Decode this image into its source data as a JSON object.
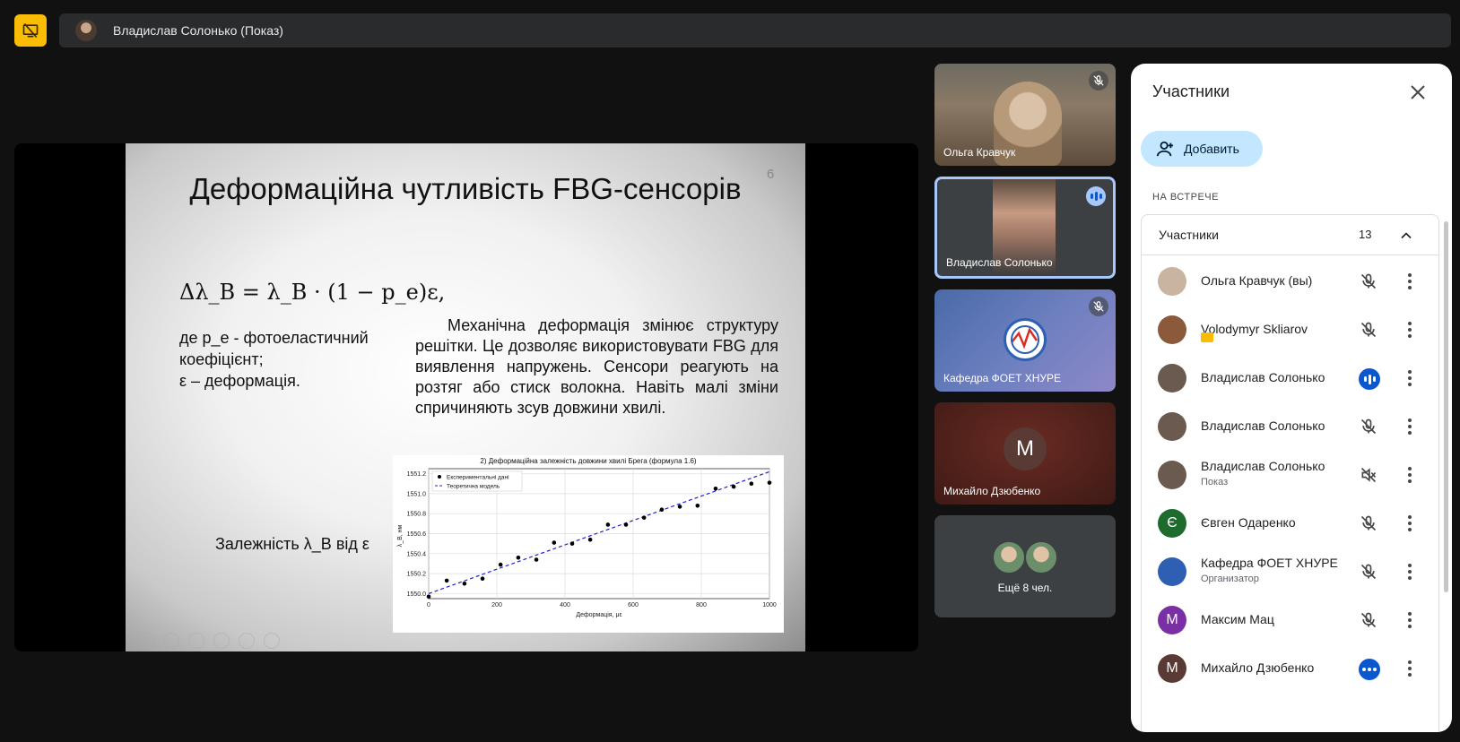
{
  "top": {
    "presenter_label": "Владислав Солонько (Показ)"
  },
  "slide": {
    "title": "Деформаційна чутливість FBG-сенсорів",
    "page_number": "6",
    "formula": "Δλ_B = λ_B · (1 − p_e)ε,",
    "definition_line1": "де p_e - фотоеластичний коефіцієнт;",
    "definition_line2": "ε – деформація.",
    "paragraph": "Механічна деформація змінює структуру решітки. Це дозволяє використовувати FBG для виявлення напружень. Сенсори реагують на розтяг або стиск волокна. Навіть малі зміни спричиняють зсув довжини хвилі.",
    "dependency": "Залежність λ_B від ε"
  },
  "chart_data": {
    "type": "scatter",
    "title": "2) Деформаційна залежність довжини хвилі Брега (формула 1.6)",
    "xlabel": "Деформація, με",
    "ylabel": "λ_B, нм",
    "xlim": [
      0,
      1000
    ],
    "ylim": [
      1549.95,
      1551.25
    ],
    "x_ticks": [
      "0",
      "200",
      "400",
      "600",
      "800",
      "1000"
    ],
    "y_ticks": [
      "1550.0",
      "1550.2",
      "1550.4",
      "1550.6",
      "1550.8",
      "1551.0",
      "1551.2"
    ],
    "legend_placement": "top-left",
    "grid": true,
    "series": [
      {
        "name": "Експериментальні дані",
        "style": "points",
        "color": "#000000",
        "x": [
          0,
          53,
          105,
          158,
          211,
          263,
          316,
          368,
          421,
          474,
          526,
          579,
          632,
          684,
          737,
          789,
          842,
          895,
          947,
          1000
        ],
        "y": [
          1549.97,
          1550.13,
          1550.1,
          1550.15,
          1550.29,
          1550.36,
          1550.34,
          1550.51,
          1550.5,
          1550.54,
          1550.69,
          1550.69,
          1550.76,
          1550.84,
          1550.87,
          1550.88,
          1551.05,
          1551.07,
          1551.1,
          1551.11
        ]
      },
      {
        "name": "Теоретична модель",
        "style": "dashed-line",
        "color": "#2222cc",
        "x": [
          0,
          1000
        ],
        "y": [
          1550.0,
          1551.22
        ]
      }
    ]
  },
  "tiles": [
    {
      "name": "Ольга Кравчук"
    },
    {
      "name": "Владислав Солонько"
    },
    {
      "name": "Кафедра ФОЕТ ХНУРЕ"
    },
    {
      "name": "Михайло Дзюбенко",
      "initial": "M"
    },
    {
      "more": "Ещё 8 чел."
    }
  ],
  "panel": {
    "title": "Участники",
    "add_label": "Добавить",
    "section": "НА ВСТРЕЧЕ",
    "group_label": "Участники",
    "count": "13",
    "participants": [
      {
        "name": "Ольга Кравчук (вы)",
        "sub": "",
        "avatar_color": "#c8b4a0",
        "initial": "",
        "status": "mic-off"
      },
      {
        "name": "Volodymyr Skliarov",
        "sub": "",
        "avatar_color": "#8a5a3a",
        "initial": "",
        "status": "mic-off"
      },
      {
        "name": "Владислав Солонько",
        "sub": "",
        "avatar_color": "#6b5a50",
        "initial": "",
        "status": "speaking"
      },
      {
        "name": "Владислав Солонько",
        "sub": "",
        "avatar_color": "#6b5a50",
        "initial": "",
        "status": "mic-off"
      },
      {
        "name": "Владислав Солонько",
        "sub": "Показ",
        "avatar_color": "#6b5a50",
        "initial": "",
        "status": "audio-off"
      },
      {
        "name": "Євген Одаренко",
        "sub": "",
        "avatar_color": "#1e6b2e",
        "initial": "Є",
        "status": "mic-off"
      },
      {
        "name": "Кафедра ФОЕТ ХНУРЕ",
        "sub": "Организатор",
        "avatar_color": "#2f5fb3",
        "initial": "",
        "status": "mic-off"
      },
      {
        "name": "Максим Мац",
        "sub": "",
        "avatar_color": "#7b2fa5",
        "initial": "M",
        "status": "mic-off"
      },
      {
        "name": "Михайло Дзюбенко",
        "sub": "",
        "avatar_color": "#5a3a34",
        "initial": "M",
        "status": "more"
      }
    ]
  }
}
